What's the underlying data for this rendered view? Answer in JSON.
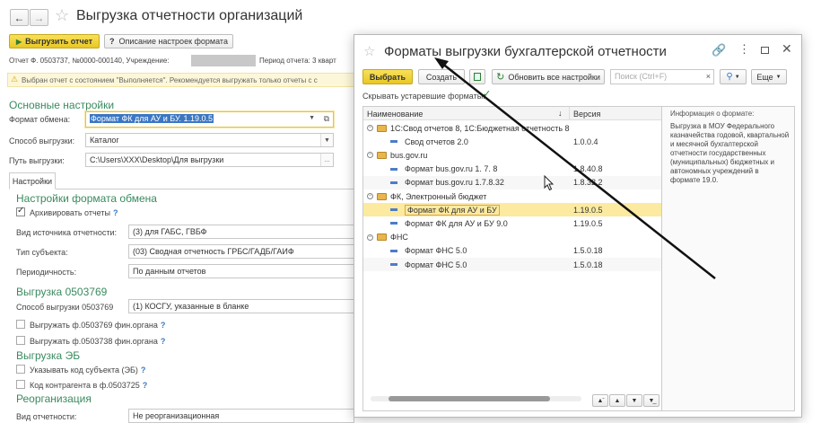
{
  "main": {
    "title": "Выгрузка отчетности организаций",
    "toolbar": {
      "upload_label": "Выгрузить отчет",
      "help_label": "Описание настроек формата"
    },
    "info_line_prefix": "Отчет Ф. 0503737, №0000-000140, Учреждение:",
    "info_line_period": "Период отчета: 3 кварт",
    "warning": "Выбран отчет с состоянием \"Выполняется\". Рекомендуется выгружать только отчеты с с",
    "basic_section": "Основные настройки",
    "format_label": "Формат обмена:",
    "format_value": "Формат ФК для АУ и БУ. 1.19.0.5",
    "method_label": "Способ выгрузки:",
    "method_value": "Каталог",
    "path_label": "Путь выгрузки:",
    "path_value": "C:\\Users\\XXX\\Desktop\\Для выгрузки",
    "tab_settings": "Настройки",
    "exchange_section": "Настройки формата обмена",
    "archive_label": "Архивировать отчеты",
    "source_label": "Вид источника отчетности:",
    "source_value": "(3) для ГАБС, ГВБФ",
    "subject_label": "Тип субъекта:",
    "subject_value": "(03) Сводная отчетность ГРБС/ГАДБ/ГАИФ",
    "period_label": "Периодичность:",
    "period_value": "По данным отчетов",
    "upload769_section": "Выгрузка 0503769",
    "method769_label": "Способ выгрузки 0503769",
    "method769_value": "(1) КОСГУ, указанные в бланке",
    "fin769_label": "Выгружать ф.0503769 фин.органа",
    "fin738_label": "Выгружать ф.0503738 фин.органа",
    "eb_section": "Выгрузка ЭБ",
    "subject_code_label": "Указывать код субъекта (ЭБ)",
    "counterparty_label": "Код контрагента в ф.0503725",
    "reorg_section": "Реорганизация",
    "report_kind_label": "Вид отчетности:",
    "report_kind_value": "Не реорганизационная",
    "help_mark": "?"
  },
  "dialog": {
    "title": "Форматы выгрузки бухгалтерской отчетности",
    "select_label": "Выбрать",
    "create_label": "Создать",
    "update_all_label": "Обновить все настройки",
    "search_placeholder": "Поиск (Ctrl+F)",
    "more_label": "Еще",
    "hide_obsolete_label": "Скрывать устаревшие форматы:",
    "col_name": "Наименование",
    "col_version": "Версия",
    "info_title": "Информация о формате:",
    "info_text": "Выгрузка в МОУ Федерального казначейства годовой, квартальной и месячной бухгалтерской отчетности государственных (муниципальных) бюджетных и автономных учреждений в формате 19.0.",
    "rows": [
      {
        "type": "group",
        "name": "1С:Свод отчетов 8, 1С:Бюджетная отчетность 8",
        "version": ""
      },
      {
        "type": "item",
        "name": "Свод отчетов 2.0",
        "version": "1.0.0.4"
      },
      {
        "type": "group",
        "name": "bus.gov.ru",
        "version": ""
      },
      {
        "type": "item",
        "name": "Формат bus.gov.ru  1. 7. 8",
        "version": "1.8.40.8"
      },
      {
        "type": "item",
        "name": "Формат bus.gov.ru  1.7.8.32",
        "version": "1.8.32.2"
      },
      {
        "type": "group",
        "name": "ФК, Электронный бюджет",
        "version": ""
      },
      {
        "type": "item",
        "name": "Формат ФК для АУ и БУ",
        "version": "1.19.0.5",
        "selected": true
      },
      {
        "type": "item",
        "name": "Формат ФК для АУ и БУ  9.0",
        "version": "1.19.0.5"
      },
      {
        "type": "group",
        "name": "ФНС",
        "version": ""
      },
      {
        "type": "item",
        "name": "Формат ФНС 5.0",
        "version": "1.5.0.18"
      },
      {
        "type": "item",
        "name": "Формат ФНС 5.0",
        "version": "1.5.0.18"
      }
    ]
  },
  "colors": {
    "accent_green": "#3a8a5f",
    "button_yellow": "#f0d23a",
    "selection_yellow": "#fbeaa0",
    "warning_bg": "#fdf7d9"
  }
}
